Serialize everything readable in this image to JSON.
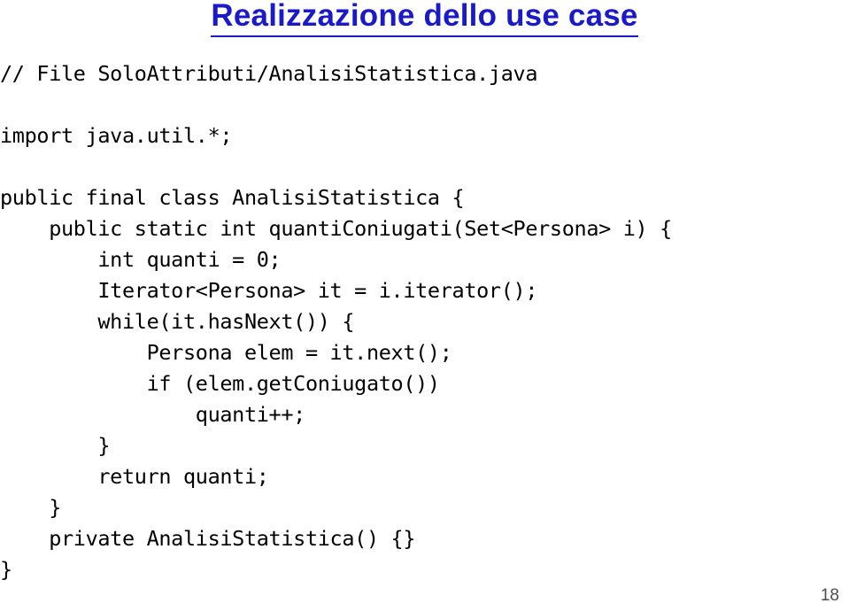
{
  "slide": {
    "title": "Realizzazione dello use case",
    "title_color": "#1a1ac8",
    "background_color": "#ffffff",
    "page_number": "18",
    "page_number_color": "#4d4d4d",
    "code_color": "#000000"
  },
  "code": {
    "language": "java",
    "lines": [
      "// File SoloAttributi/AnalisiStatistica.java",
      "",
      "import java.util.*;",
      "",
      "public final class AnalisiStatistica {",
      "    public static int quantiConiugati(Set<Persona> i) {",
      "        int quanti = 0;",
      "        Iterator<Persona> it = i.iterator();",
      "        while(it.hasNext()) {",
      "            Persona elem = it.next();",
      "            if (elem.getConiugato())",
      "                quanti++;",
      "        }",
      "        return quanti;",
      "    }",
      "    private AnalisiStatistica() {}",
      "}"
    ]
  }
}
